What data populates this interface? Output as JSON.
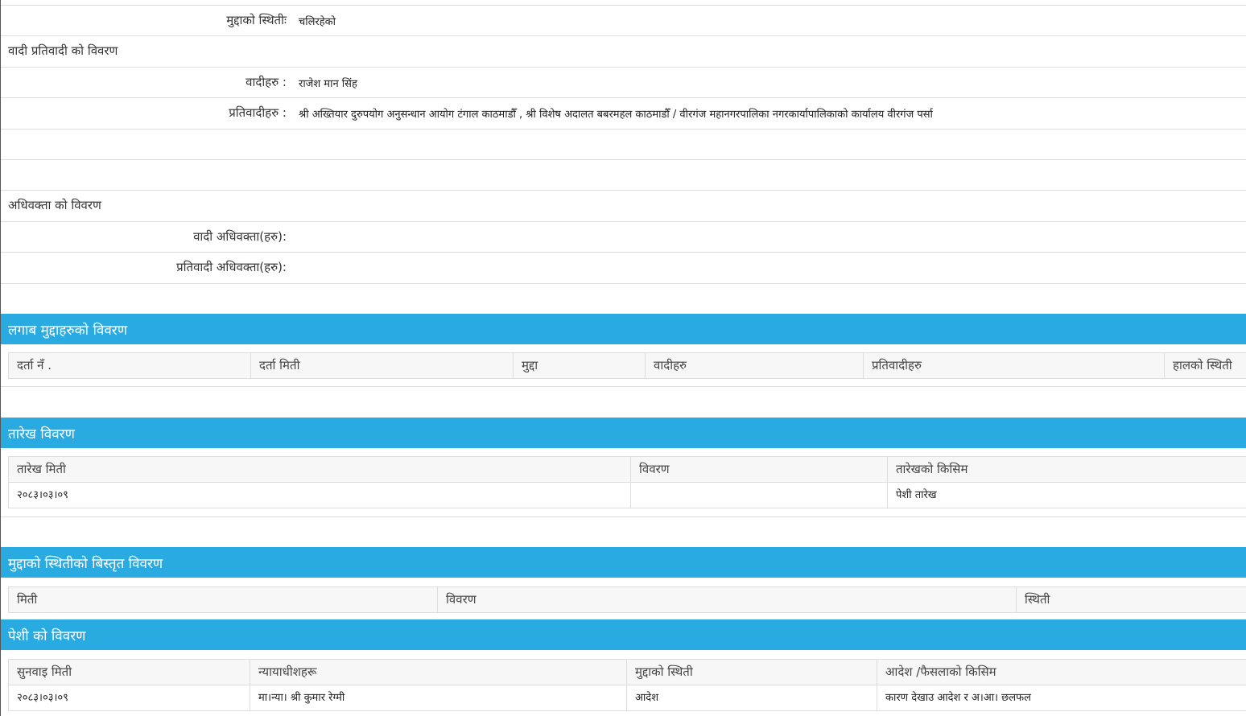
{
  "case_status": {
    "label": "मुद्दाको स्थितीः",
    "value": "चलिरहेको"
  },
  "parties": {
    "title": "वादी प्रतिवादी को विवरण",
    "plaintiffs_label": "वादीहरु :",
    "plaintiffs_value": "राजेश मान सिंह",
    "defendants_label": "प्रतिवादीहरु :",
    "defendants_value": "श्री अख्तियार दुरुपयोग अनुसन्धान आयोग टंगाल काठमाडौँ , श्री विशेष अदालत बबरमहल काठमाडौँ / वीरगंज महानगरपालिका नगरकार्यापालिकाको कार्यालय वीरगंज पर्सा"
  },
  "advocates": {
    "title": "अधिवक्ता को विवरण",
    "plaintiff_label": "वादी अधिवक्ता(हरु):",
    "plaintiff_value": "",
    "defendant_label": "प्रतिवादी अधिवक्ता(हरु):",
    "defendant_value": ""
  },
  "related_cases": {
    "title": "लगाब मुद्दाहरुको विवरण",
    "columns": [
      "दर्ता नँ .",
      "दर्ता मिती",
      "मुद्दा",
      "वादीहरु",
      "प्रतिवादीहरु",
      "हालको स्थिती"
    ]
  },
  "hearing_dates": {
    "title": "तारेख विवरण",
    "columns": [
      "तारेख मिती",
      "विवरण",
      "तारेखको किसिम"
    ],
    "rows": [
      [
        "२०८३।०३।०९",
        "",
        "पेशी तारेख"
      ]
    ]
  },
  "status_details": {
    "title": "मुद्दाको स्थितीको बिस्तृत विवरण",
    "columns": [
      "मिती",
      "विवरण",
      "स्थिती"
    ]
  },
  "hearing_details": {
    "title": "पेशी को विवरण",
    "columns": [
      "सुनवाइ मिती",
      "न्यायाधीशहरू",
      "मुद्दाको स्थिती",
      "आदेश /फैसलाको किसिम"
    ],
    "rows": [
      [
        "२०८३।०३।०९",
        "मा।न्या। श्री कुमार रेग्मी",
        "आदेश",
        "कारण देखाउ आदेश र अ।आ। छलफल"
      ]
    ]
  },
  "colors": {
    "band": "#29abe2",
    "border": "#dddddd",
    "header_bg": "#f7f7f7"
  }
}
